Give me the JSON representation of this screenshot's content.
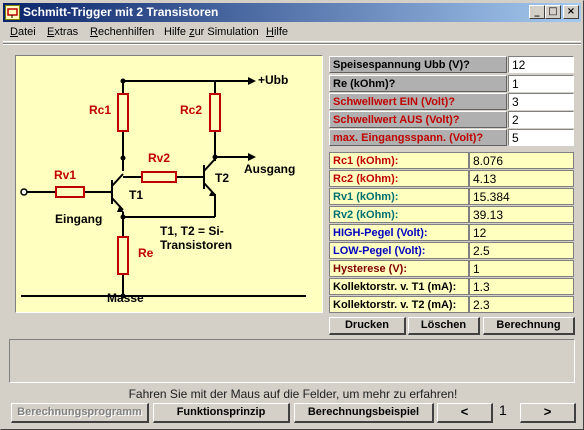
{
  "window": {
    "title": "Schmitt-Trigger mit 2 Transistoren"
  },
  "titlebar_buttons": {
    "minimize": "_",
    "maximize": "□",
    "close": "×"
  },
  "menu": {
    "items": [
      {
        "label": "Datei",
        "hotkey": "D"
      },
      {
        "label": "Extras",
        "hotkey": "E"
      },
      {
        "label": "Rechenhilfen",
        "hotkey": "R"
      },
      {
        "label": "Hilfe zur Simulation",
        "hotkey": "z"
      },
      {
        "label": "Hilfe",
        "hotkey": "H"
      }
    ]
  },
  "schematic": {
    "ubb": "+Ubb",
    "rc1": "Rc1",
    "rc2": "Rc2",
    "rv1": "Rv1",
    "rv2": "Rv2",
    "t1": "T1",
    "t2": "T2",
    "re": "Re",
    "eingang": "Eingang",
    "ausgang": "Ausgang",
    "note_line1": "T1, T2 = Si-",
    "note_line2": "Transistoren",
    "masse": "Masse"
  },
  "inputs": [
    {
      "label": "Speisespannung Ubb (V)?",
      "value": "12",
      "color": "black"
    },
    {
      "label": "Re (kOhm)?",
      "value": "1",
      "color": "black"
    },
    {
      "label": "Schwellwert EIN (Volt)?",
      "value": "3",
      "color": "red"
    },
    {
      "label": "Schwellwert AUS (Volt)?",
      "value": "2",
      "color": "red"
    },
    {
      "label": "max. Eingangsspann. (Volt)?",
      "value": "5",
      "color": "red"
    }
  ],
  "results": [
    {
      "label": "Rc1 (kOhm):",
      "value": "8.076",
      "color": "red"
    },
    {
      "label": "Rc2 (kOhm):",
      "value": "4.13",
      "color": "red"
    },
    {
      "label": "Rv1 (kOhm):",
      "value": "15.384",
      "color": "teal"
    },
    {
      "label": "Rv2 (kOhm):",
      "value": "39.13",
      "color": "teal"
    },
    {
      "label": "HIGH-Pegel (Volt):",
      "value": "12",
      "color": "blue"
    },
    {
      "label": "LOW-Pegel (Volt):",
      "value": "2.5",
      "color": "blue"
    },
    {
      "label": "Hysterese (V):",
      "value": "1",
      "color": "maroon"
    },
    {
      "label": "Kollektorstr. v. T1 (mA):",
      "value": "1.3",
      "color": "black"
    },
    {
      "label": "Kollektorstr. v. T2 (mA):",
      "value": "2.3",
      "color": "black"
    }
  ],
  "actions": {
    "print": "Drucken",
    "clear": "Löschen",
    "calculate": "Berechnung"
  },
  "hint": "Fahren Sie mit der Maus auf die Felder, um mehr zu erfahren!",
  "bottom": {
    "program": "Berechnungsprogramm",
    "principle": "Funktionsprinzip",
    "example": "Berechnungsbeispiel",
    "prev": "<",
    "page": "1",
    "next": ">"
  },
  "colors": {
    "title_from": "#0a246a",
    "title_to": "#a6caf0",
    "schematic_bg": "#ffffc0",
    "label_red": "#c00000"
  }
}
